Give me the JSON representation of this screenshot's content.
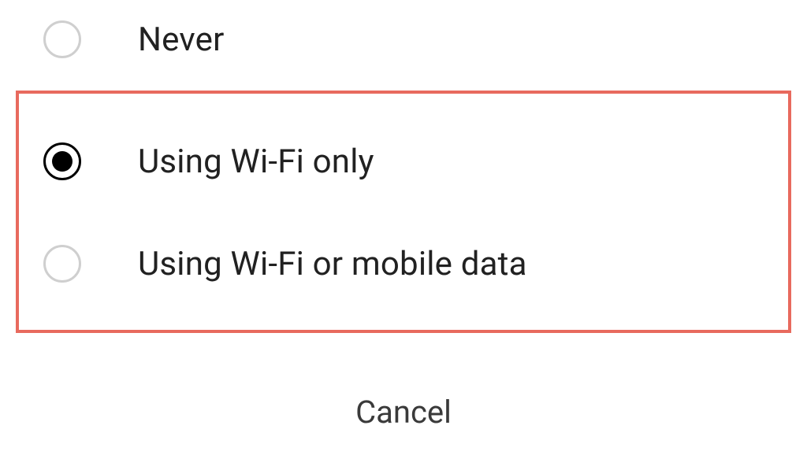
{
  "options": [
    {
      "label": "Never",
      "selected": false
    },
    {
      "label": "Using Wi-Fi only",
      "selected": true
    },
    {
      "label": "Using Wi-Fi or mobile data",
      "selected": false
    }
  ],
  "cancel_label": "Cancel",
  "highlight_color": "#e86a5e"
}
